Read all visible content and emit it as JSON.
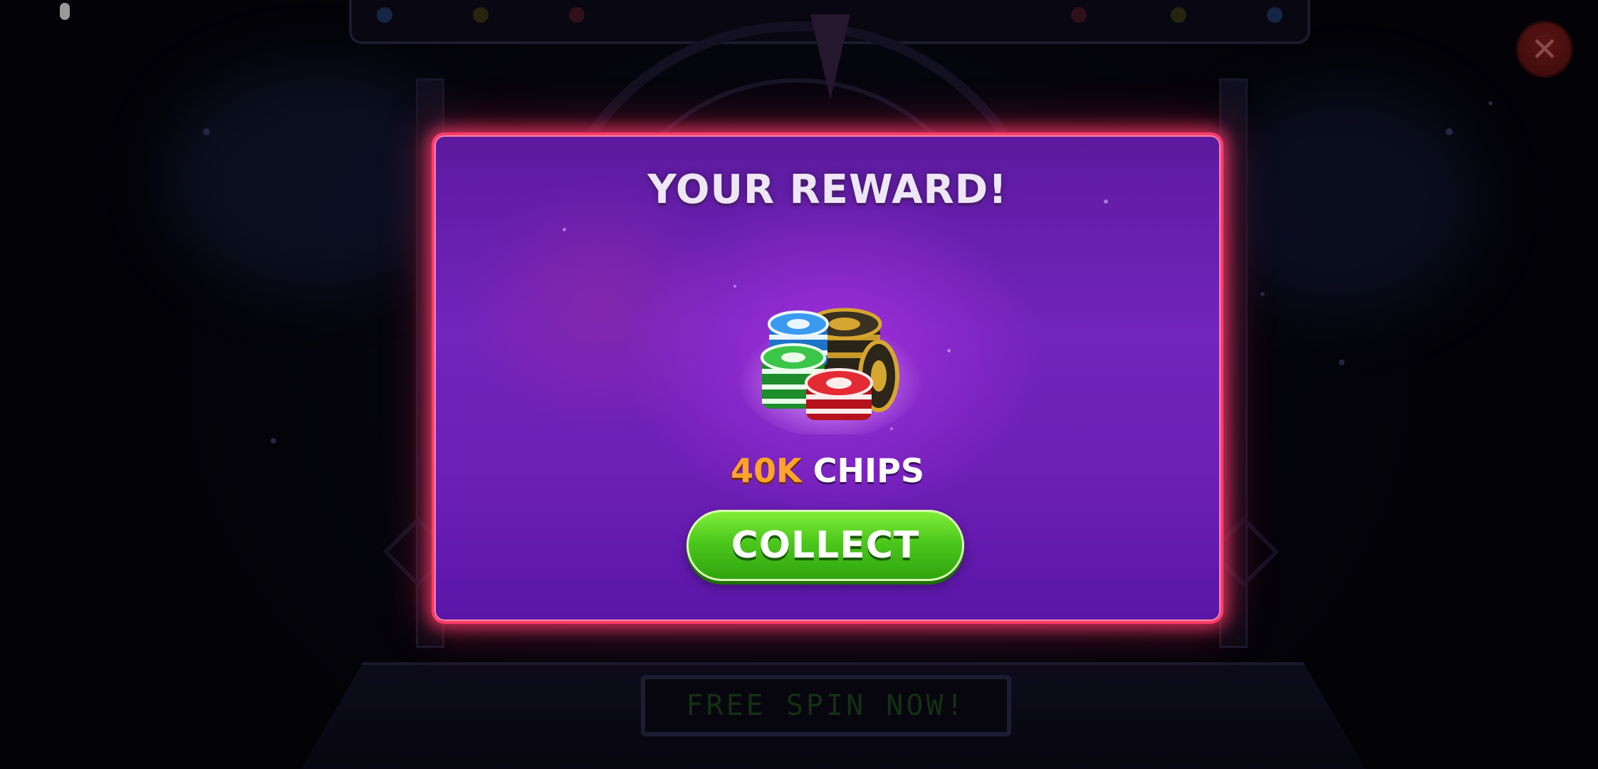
{
  "background": {
    "free_spin_label": "FREE SPIN NOW!",
    "left_label": "",
    "right_label": ""
  },
  "close_button": {
    "icon": "close-icon",
    "glyph": "✕"
  },
  "modal": {
    "title": "YOUR REWARD!",
    "reward": {
      "amount": "40K",
      "unit": "CHIPS",
      "icon": "poker-chips-icon"
    },
    "collect_button": {
      "label": "COLLECT"
    }
  },
  "colors": {
    "modal_border": "#ff3c6a",
    "modal_bg": "#7224bc",
    "reward_amount": "#ffa32a",
    "collect_button": "#4cc81c"
  }
}
